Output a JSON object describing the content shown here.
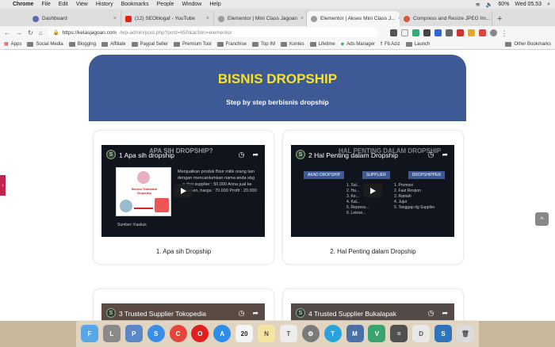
{
  "menubar": {
    "apple": "",
    "app": "Chrome",
    "items": [
      "File",
      "Edit",
      "View",
      "History",
      "Bookmarks",
      "People",
      "Window",
      "Help"
    ],
    "battery": "60%",
    "clock": "Wed 05.53"
  },
  "tabs": [
    {
      "label": "Dashboard",
      "color": "#5b6bb0"
    },
    {
      "label": "(12) SEOblogaf - YouTube",
      "color": "#e62117"
    },
    {
      "label": "Elementor | Mini Class Jagoan",
      "color": "#9c9c9c"
    },
    {
      "label": "Elementor | Akses Mini Class J...",
      "color": "#9c9c9c",
      "active": true
    },
    {
      "label": "Compress and Resize JPEG Im...",
      "color": "#d8583f"
    }
  ],
  "address": {
    "url": "https://kelasjagoan.com",
    "path": "/wp-admin/post.php?post=650&action=elementor"
  },
  "bookmarks": [
    "Apps",
    "Social Media",
    "Blogging",
    "Affiliate",
    "Paypal Seller",
    "Premium Tool",
    "Franchise",
    "Top IM",
    "Kontes",
    "Lifetime",
    "Ads Manager",
    "Fb Aziz",
    "Launch"
  ],
  "bookmarks_other": "Other Bookmarks",
  "hero": {
    "title": "BISNIS DROPSHIP",
    "subtitle": "Step by step berbisnis dropship"
  },
  "cards": [
    {
      "video_title": "1 Apa sih dropship",
      "caption": "1. Apa sih Dropship",
      "slide_heading": "APA SIH DROPSHIP?",
      "slide_text": "Menjualkan produk Bisir milik orang lain dengan mencantumkan nama anda sbg ... a dari supplier : 50.000 Anna jual ke konsumen, harga : 70.000 Profit : 20.000",
      "slide_credit": "Sumber: Kaskus",
      "slide_label": "Skema Transaksi Dropship"
    },
    {
      "video_title": "2 Hal Penting dalam Dropship",
      "caption": "2. Hal Penting dalam Dropship",
      "slide_heading": "HAL PENTING DALAM DROPSHIP",
      "cols": [
        "AKAD DROPSHIP",
        "SUPPLIER",
        "DROPSHIPPER"
      ],
      "list_left": [
        "1. Sal...",
        "2. Ha...",
        "3. Ke...",
        "4. Kal...",
        "5. Repress...",
        "6. Lelese..."
      ],
      "list_right": [
        "1. Promosi",
        "2. Fast Respon",
        "3. Ramah",
        "4. Jujur",
        "5. Tanggap dg Supplier"
      ]
    },
    {
      "video_title": "3 Trusted Supplier Tokopedia"
    },
    {
      "video_title": "4 Trusted Supplier Bukalapak"
    }
  ],
  "sidetab": "›",
  "scrolltop": "^",
  "dock": [
    {
      "name": "finder",
      "label": "F",
      "color": "#5aa7e8"
    },
    {
      "name": "launchpad",
      "label": "L",
      "color": "#8a8a8a"
    },
    {
      "name": "preview",
      "label": "P",
      "color": "#5d87c6"
    },
    {
      "name": "safari",
      "label": "S",
      "color": "#3b8ee8"
    },
    {
      "name": "chrome",
      "label": "C",
      "color": "#e5453a"
    },
    {
      "name": "opera",
      "label": "O",
      "color": "#e0201f"
    },
    {
      "name": "app-store",
      "label": "A",
      "color": "#2e8de8"
    },
    {
      "name": "calendar",
      "label": "20",
      "color": "#f4f4f4"
    },
    {
      "name": "notes",
      "label": "N",
      "color": "#f6e5a0"
    },
    {
      "name": "textedit",
      "label": "T",
      "color": "#ededed"
    },
    {
      "name": "system-preferences",
      "label": "⚙",
      "color": "#7a7a7a"
    },
    {
      "name": "telegram",
      "label": "T",
      "color": "#2aa3dd"
    },
    {
      "name": "mail",
      "label": "M",
      "color": "#4a6fa5"
    },
    {
      "name": "vpn",
      "label": "V",
      "color": "#3aa46e"
    },
    {
      "name": "calculator",
      "label": "=",
      "color": "#505050"
    },
    {
      "name": "document",
      "label": "D",
      "color": "#e8e8e8"
    },
    {
      "name": "scribe",
      "label": "S",
      "color": "#2f73b8"
    },
    {
      "name": "trash",
      "label": "🗑",
      "color": "#dcdcdc"
    }
  ]
}
